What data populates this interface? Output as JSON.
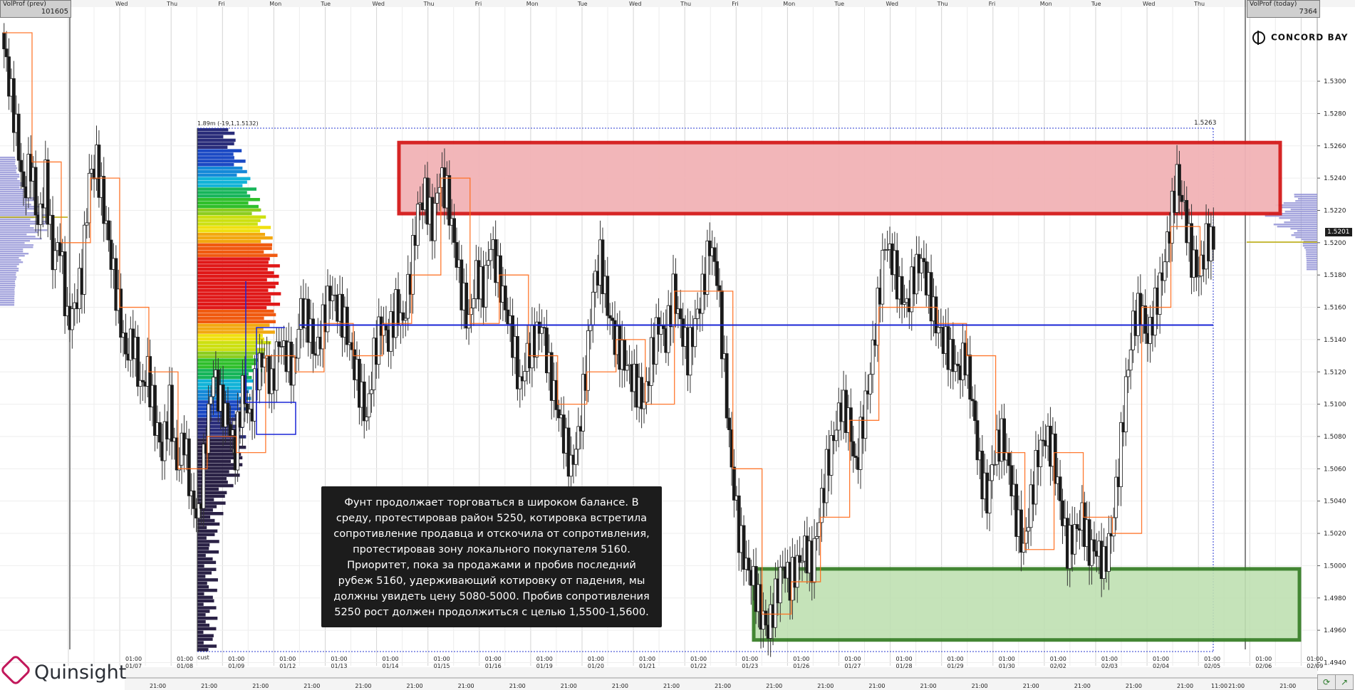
{
  "header": {
    "volprof_prev": {
      "title": "VolProf (prev)",
      "value": "101605"
    },
    "volprof_today": {
      "title": "VolProf (today)",
      "value": "7364"
    },
    "brand": "CONCORD BAY",
    "watermark": "Quinsight"
  },
  "annotation": {
    "text": "Фунт продолжает торговаться в широком балансе. В среду, протестировав район 5250, котировка встретила сопротивление продавца и отскочила от сопротивления, протестировав зону локального покупателя 5160. Приоритет, пока за продажами и пробив последний рубеж 5160, удерживающий котировку от падения, мы должны увидеть цену 5080-5000. Пробив сопротивления 5250 рост должен продолжиться с целью 1,5500-1,5600."
  },
  "price_labels": {
    "last": "1.5201",
    "high_marker": "1.5263",
    "profile_info": "1.89m (-19,1,1.5132)",
    "cust": "cust"
  },
  "colors": {
    "candle_up": "#ffffff",
    "candle_down": "#1a1a1a",
    "wick": "#333333",
    "resistance_fill": "#f2b3b6",
    "resistance_border": "#d41a1a",
    "support_fill": "#bfe0b2",
    "support_border": "#2f7a1e",
    "level_line": "#1a25d6",
    "step_line": "#ff6a1a"
  },
  "chart_data": {
    "type": "candlestick",
    "y_axis": {
      "ylim": [
        1.4938,
        1.5345
      ],
      "ticks": [
        "1.5300",
        "1.5280",
        "1.5260",
        "1.5240",
        "1.5220",
        "1.5200",
        "1.5180",
        "1.5160",
        "1.5140",
        "1.5120",
        "1.5100",
        "1.5080",
        "1.5060",
        "1.5040",
        "1.5020",
        "1.5000",
        "1.4980",
        "1.4960",
        "1.4940"
      ]
    },
    "weekdays_top": [
      "Wed",
      "Thu",
      "Fri",
      "Mon",
      "Tue",
      "Wed",
      "Thu",
      "Fri",
      "Mon",
      "Tue",
      "Wed",
      "Thu",
      "Fri",
      "Mon",
      "Tue",
      "Wed",
      "Thu",
      "Fri",
      "Mon",
      "Tue",
      "Wed",
      "Thu"
    ],
    "dates_bottom": [
      "01/07",
      "01/08",
      "01/09",
      "01/12",
      "01/13",
      "01/14",
      "01/15",
      "01/16",
      "01/19",
      "01/20",
      "01/21",
      "01/22",
      "01/23",
      "01/26",
      "01/27",
      "01/28",
      "01/29",
      "01/30",
      "02/02",
      "02/03",
      "02/04",
      "02/05",
      "02/06",
      "02/09"
    ],
    "time_top": "01:00",
    "time_bottom": "21:00",
    "time_extra": "11:00",
    "resistance_zone": {
      "from": 1.5218,
      "to": 1.5262
    },
    "support_zone": {
      "from": 1.4954,
      "to": 1.4998
    },
    "level": 1.5149,
    "path": [
      1.533,
      1.53,
      1.527,
      1.523,
      1.525,
      1.521,
      1.524,
      1.519,
      1.52,
      1.515,
      1.516,
      1.518,
      1.524,
      1.525,
      1.522,
      1.519,
      1.516,
      1.513,
      1.514,
      1.511,
      1.512,
      1.509,
      1.507,
      1.51,
      1.506,
      1.508,
      1.504,
      1.503,
      1.508,
      1.512,
      1.51,
      1.509,
      1.507,
      1.511,
      1.509,
      1.512,
      1.513,
      1.511,
      1.514,
      1.513,
      1.512,
      1.516,
      1.515,
      1.513,
      1.515,
      1.517,
      1.516,
      1.515,
      1.513,
      1.511,
      1.509,
      1.513,
      1.515,
      1.514,
      1.516,
      1.515,
      1.518,
      1.522,
      1.523,
      1.521,
      1.524,
      1.523,
      1.52,
      1.517,
      1.515,
      1.518,
      1.517,
      1.52,
      1.518,
      1.516,
      1.514,
      1.511,
      1.513,
      1.514,
      1.515,
      1.512,
      1.51,
      1.508,
      1.506,
      1.508,
      1.512,
      1.517,
      1.519,
      1.516,
      1.514,
      1.513,
      1.512,
      1.511,
      1.51,
      1.513,
      1.515,
      1.514,
      1.517,
      1.515,
      1.513,
      1.515,
      1.517,
      1.52,
      1.518,
      1.512,
      1.506,
      1.502,
      1.5,
      1.499,
      1.497,
      1.496,
      1.498,
      1.5,
      1.499,
      1.5,
      1.501,
      1.5,
      1.503,
      1.506,
      1.508,
      1.51,
      1.509,
      1.506,
      1.509,
      1.512,
      1.516,
      1.52,
      1.519,
      1.517,
      1.516,
      1.518,
      1.519,
      1.517,
      1.515,
      1.514,
      1.513,
      1.512,
      1.513,
      1.51,
      1.506,
      1.504,
      1.507,
      1.508,
      1.506,
      1.503,
      1.501,
      1.504,
      1.507,
      1.508,
      1.507,
      1.504,
      1.501,
      1.502,
      1.503,
      1.501,
      1.501,
      1.5,
      1.502,
      1.506,
      1.511,
      1.515,
      1.516,
      1.514,
      1.516,
      1.518,
      1.521,
      1.524,
      1.522,
      1.519,
      1.518,
      1.52,
      1.5201
    ]
  },
  "footer": {
    "refresh_icon": "refresh-icon",
    "arrow_icon": "arrow-up-right-icon"
  }
}
